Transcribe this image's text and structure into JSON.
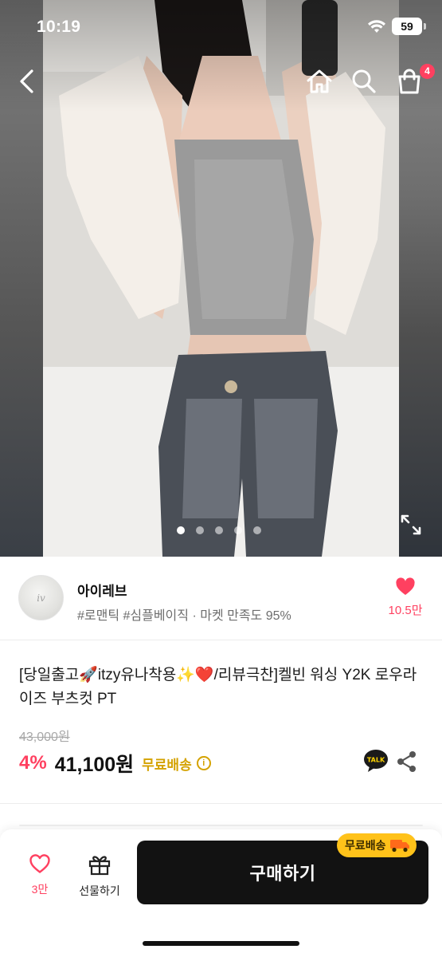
{
  "status_bar": {
    "time": "10:19",
    "battery": "59"
  },
  "top_nav": {
    "cart_count": "4"
  },
  "carousel": {
    "total_images": 5,
    "active_index": 0
  },
  "shop": {
    "name": "아이레브",
    "tags": "#로맨틱 #심플베이직 · 마켓 만족도 95%",
    "avatar_text": "iv",
    "like_count": "10.5만"
  },
  "product": {
    "title": "[당일출고🚀itzy유나착용✨❤️/리뷰극찬]켈빈 워싱 Y2K 로우라이즈 부츠컷 PT",
    "original_price": "43,000원",
    "discount": "4%",
    "sale_price": "41,100원",
    "shipping": "무료배송"
  },
  "bottom_bar": {
    "like_label": "3만",
    "gift_label": "선물하기",
    "buy_label": "구매하기",
    "free_ship_badge": "무료배송"
  },
  "colors": {
    "accent_pink": "#ff4060",
    "shipping_yellow": "#d4a200",
    "badge_yellow": "#ffc21a",
    "buy_button": "#121212"
  },
  "icons": {
    "back": "chevron-left-icon",
    "home": "home-icon",
    "search": "search-icon",
    "cart": "shopping-bag-icon",
    "expand": "expand-icon",
    "heart": "heart-icon",
    "talk": "talk-icon",
    "share": "share-icon",
    "gift": "gift-icon",
    "truck": "truck-icon"
  }
}
